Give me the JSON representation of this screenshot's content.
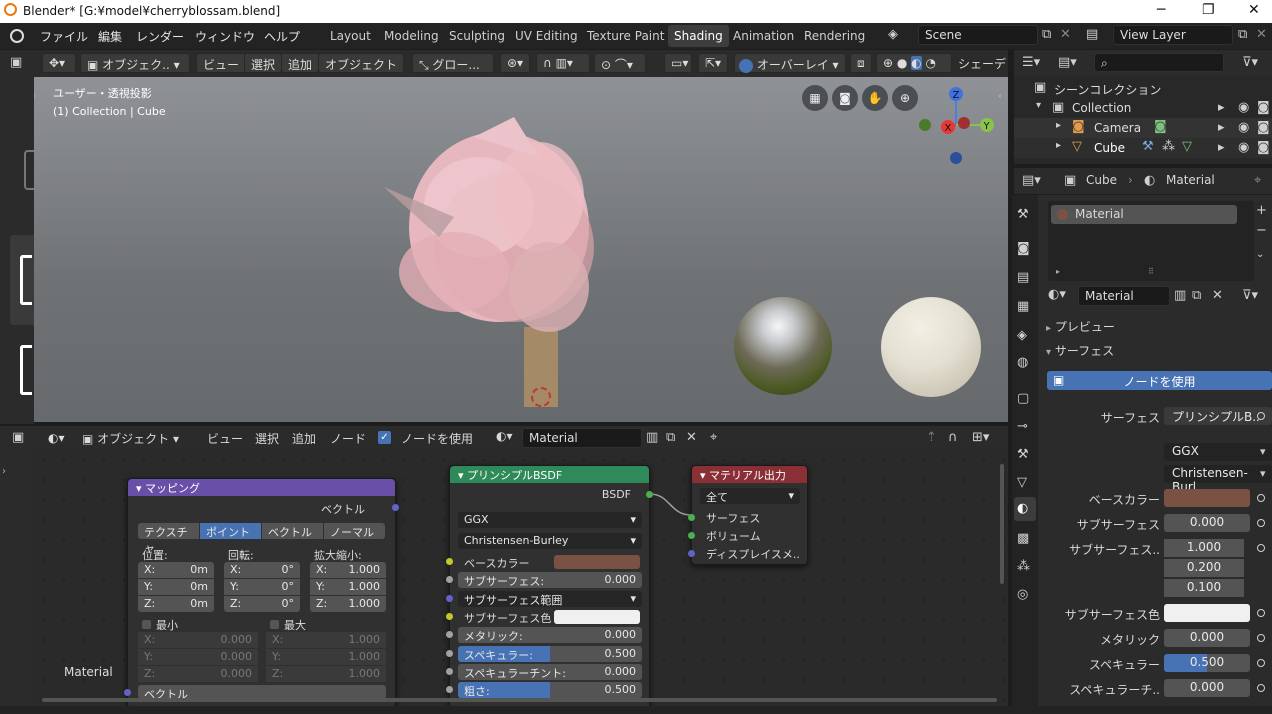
{
  "window": {
    "title": "Blender* [G:¥model¥cherryblossam.blend]",
    "minimize": "─",
    "maximize": "❐",
    "close": "✕"
  },
  "menu": {
    "items": [
      "ファイル",
      "編集",
      "レンダー",
      "ウィンドウ",
      "ヘルプ"
    ]
  },
  "workspaces": [
    "Layout",
    "Modeling",
    "Sculpting",
    "UV Editing",
    "Texture Paint",
    "Shading",
    "Animation",
    "Rendering"
  ],
  "active_workspace": "Shading",
  "scene": {
    "name": "Scene",
    "view_layer": "View Layer"
  },
  "viewport": {
    "header": {
      "mode": "オブジェク..",
      "view": "ビュー",
      "select": "選択",
      "add": "追加",
      "object": "オブジェクト",
      "transform": "グロー...",
      "overlay": "オーバーレイ",
      "shading": "シェーデ"
    },
    "info_line1": "ユーザー・透視投影",
    "info_line2": "(1) Collection | Cube",
    "gizmo": {
      "z": "Z",
      "x": "X",
      "y": "Y"
    }
  },
  "node_editor": {
    "header": {
      "mode": "オブジェクト",
      "view": "ビュー",
      "select": "選択",
      "add": "追加",
      "node": "ノード",
      "use_nodes": "ノードを使用",
      "material": "Material"
    },
    "mapping": {
      "title": "マッピング",
      "out": "ベクトル",
      "tabs": [
        "テクスチャ",
        "ポイント",
        "ベクトル",
        "ノーマル"
      ],
      "active_tab": "ポイント",
      "col_loc": "位置:",
      "col_rot": "回転:",
      "col_scale": "拡大縮小:",
      "loc": [
        [
          "X:",
          "0m"
        ],
        [
          "Y:",
          "0m"
        ],
        [
          "Z:",
          "0m"
        ]
      ],
      "rot": [
        [
          "X:",
          "0°"
        ],
        [
          "Y:",
          "0°"
        ],
        [
          "Z:",
          "0°"
        ]
      ],
      "scale": [
        [
          "X:",
          "1.000"
        ],
        [
          "Y:",
          "1.000"
        ],
        [
          "Z:",
          "1.000"
        ]
      ],
      "min": "最小",
      "max": "最大",
      "min_vals": [
        [
          "X:",
          "0.000"
        ],
        [
          "Y:",
          "0.000"
        ],
        [
          "Z:",
          "0.000"
        ]
      ],
      "max_vals": [
        [
          "X:",
          "1.000"
        ],
        [
          "Y:",
          "1.000"
        ],
        [
          "Z:",
          "1.000"
        ]
      ],
      "in": "ベクトル"
    },
    "bsdf": {
      "title": "プリンシプルBSDF",
      "out": "BSDF",
      "dist": "GGX",
      "sss": "Christensen-Burley",
      "base_color": "ベースカラー",
      "subsurface": "サブサーフェス:",
      "subsurface_v": "0.000",
      "sss_radius": "サブサーフェス範囲",
      "sss_color": "サブサーフェス色",
      "metallic": "メタリック:",
      "metallic_v": "0.000",
      "specular": "スペキュラー:",
      "specular_v": "0.500",
      "spec_tint": "スペキュラーチント:",
      "spec_tint_v": "0.000",
      "rough": "粗さ:",
      "rough_v": "0.500"
    },
    "output": {
      "title": "マテリアル出力",
      "target": "全て",
      "surface": "サーフェス",
      "volume": "ボリューム",
      "disp": "ディスプレイスメ.."
    },
    "frame_label": "Material"
  },
  "outliner": {
    "scene_collection": "シーンコレクション",
    "items": [
      {
        "name": "Collection"
      },
      {
        "name": "Camera"
      },
      {
        "name": "Cube"
      }
    ]
  },
  "properties": {
    "breadcrumb_object": "Cube",
    "breadcrumb_material": "Material",
    "slot": "Material",
    "material_name": "Material",
    "preview": "プレビュー",
    "surface_panel": "サーフェス",
    "use_nodes": "ノードを使用",
    "rows": [
      {
        "label": "サーフェス",
        "value": "プリンシプルB.."
      },
      {
        "label": "",
        "value": "GGX"
      },
      {
        "label": "",
        "value": "Christensen-Burl.."
      },
      {
        "label": "ベースカラー",
        "value": ""
      },
      {
        "label": "サブサーフェス",
        "value": "0.000"
      },
      {
        "label": "サブサーフェス..",
        "value": "1.000"
      },
      {
        "label": "",
        "value": "0.200"
      },
      {
        "label": "",
        "value": "0.100"
      },
      {
        "label": "サブサーフェス色",
        "value": ""
      },
      {
        "label": "メタリック",
        "value": "0.000"
      },
      {
        "label": "スペキュラー",
        "value": "0.500"
      },
      {
        "label": "スペキュラーチ..",
        "value": "0.000"
      }
    ]
  },
  "colors": {
    "base_color": "#7a5244",
    "accent": "#4772b3",
    "shader_green": "#2f8a5a",
    "output_red": "#8b2f36",
    "mapping_purple": "#6a4fa8"
  }
}
